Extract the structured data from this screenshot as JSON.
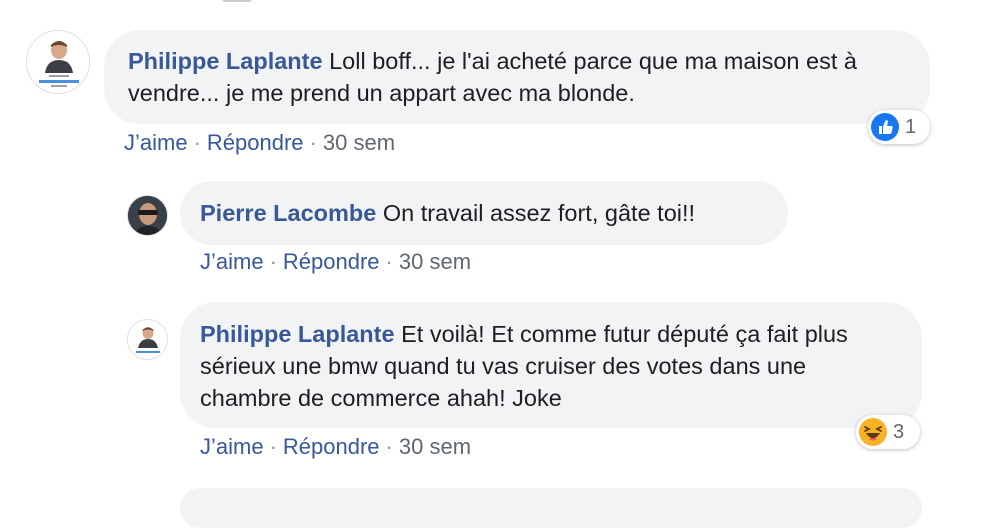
{
  "comments": [
    {
      "author": "Philippe Laplante",
      "text": "Loll boff... je l'ai acheté parce que ma maison est à vendre... je me prend un appart avec ma blonde.",
      "actions": {
        "like": "J’aime",
        "reply": "Répondre",
        "time": "30 sem"
      },
      "reaction": {
        "type": "like",
        "count": "1"
      }
    },
    {
      "author": "Pierre Lacombe",
      "text": "On travail assez fort, gâte toi!!",
      "actions": {
        "like": "J’aime",
        "reply": "Répondre",
        "time": "30 sem"
      }
    },
    {
      "author": "Philippe Laplante",
      "text": "Et voilà! Et comme futur député ça fait plus sérieux une bmw quand tu vas cruiser des votes dans une chambre de commerce ahah! Joke",
      "actions": {
        "like": "J’aime",
        "reply": "Répondre",
        "time": "30 sem"
      },
      "reaction": {
        "type": "haha",
        "count": "3"
      }
    }
  ],
  "colors": {
    "link": "#385898",
    "bubble": "#f2f3f5",
    "meta": "#606770",
    "like_blue": "#1877f2",
    "haha_yellow": "#f7b125"
  }
}
